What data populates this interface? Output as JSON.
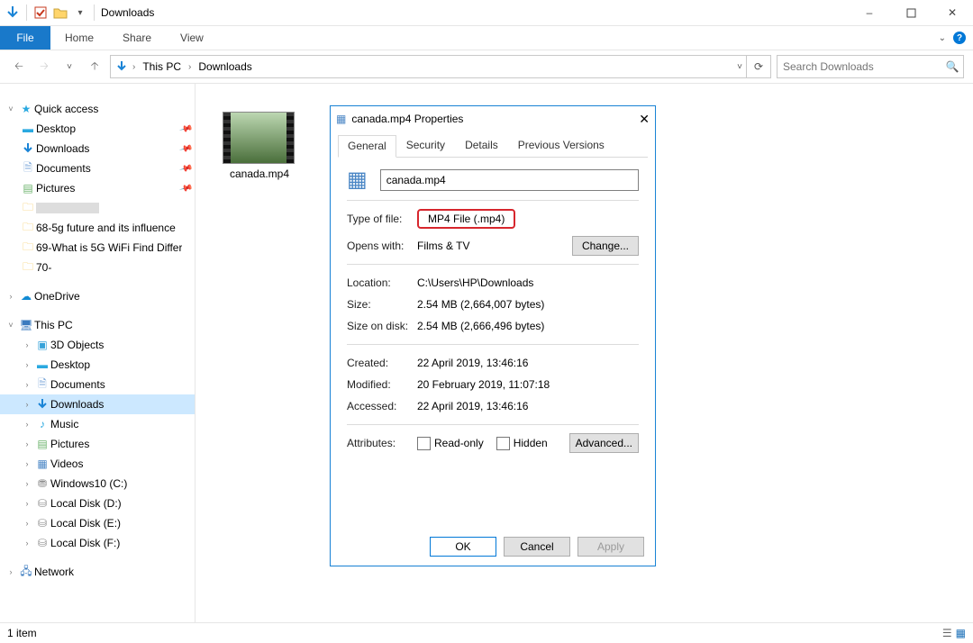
{
  "window": {
    "title": "Downloads",
    "min_tooltip": "Minimize",
    "max_tooltip": "Maximize",
    "close_tooltip": "Close"
  },
  "ribbon": {
    "file": "File",
    "tabs": [
      "Home",
      "Share",
      "View"
    ]
  },
  "address": {
    "root": "This PC",
    "folder": "Downloads",
    "search_placeholder": "Search Downloads"
  },
  "tree": {
    "quick": "Quick access",
    "quick_items": [
      "Desktop",
      "Downloads",
      "Documents",
      "Pictures"
    ],
    "recent": [
      "",
      "68-5g future and its influence",
      "69-What is 5G WiFi Find Differ",
      "70-"
    ],
    "onedrive": "OneDrive",
    "thispc": "This PC",
    "pc_items": [
      "3D Objects",
      "Desktop",
      "Documents",
      "Downloads",
      "Music",
      "Pictures",
      "Videos",
      "Windows10 (C:)",
      "Local Disk (D:)",
      "Local Disk (E:)",
      "Local Disk (F:)"
    ],
    "network": "Network"
  },
  "file": {
    "name": "canada.mp4"
  },
  "status": {
    "count": "1 item"
  },
  "dlg": {
    "title": "canada.mp4 Properties",
    "tabs": [
      "General",
      "Security",
      "Details",
      "Previous Versions"
    ],
    "filename": "canada.mp4",
    "type_label": "Type of file:",
    "type_value": "MP4 File (.mp4)",
    "opens_label": "Opens with:",
    "opens_value": "Films & TV",
    "change": "Change...",
    "location_label": "Location:",
    "location_value": "C:\\Users\\HP\\Downloads",
    "size_label": "Size:",
    "size_value": "2.54 MB (2,664,007 bytes)",
    "disk_label": "Size on disk:",
    "disk_value": "2.54 MB (2,666,496 bytes)",
    "created_label": "Created:",
    "created_value": "22 April 2019, 13:46:16",
    "modified_label": "Modified:",
    "modified_value": "20 February 2019, 11:07:18",
    "accessed_label": "Accessed:",
    "accessed_value": "22 April 2019, 13:46:16",
    "attr_label": "Attributes:",
    "readonly": "Read-only",
    "hidden": "Hidden",
    "advanced": "Advanced...",
    "ok": "OK",
    "cancel": "Cancel",
    "apply": "Apply"
  }
}
